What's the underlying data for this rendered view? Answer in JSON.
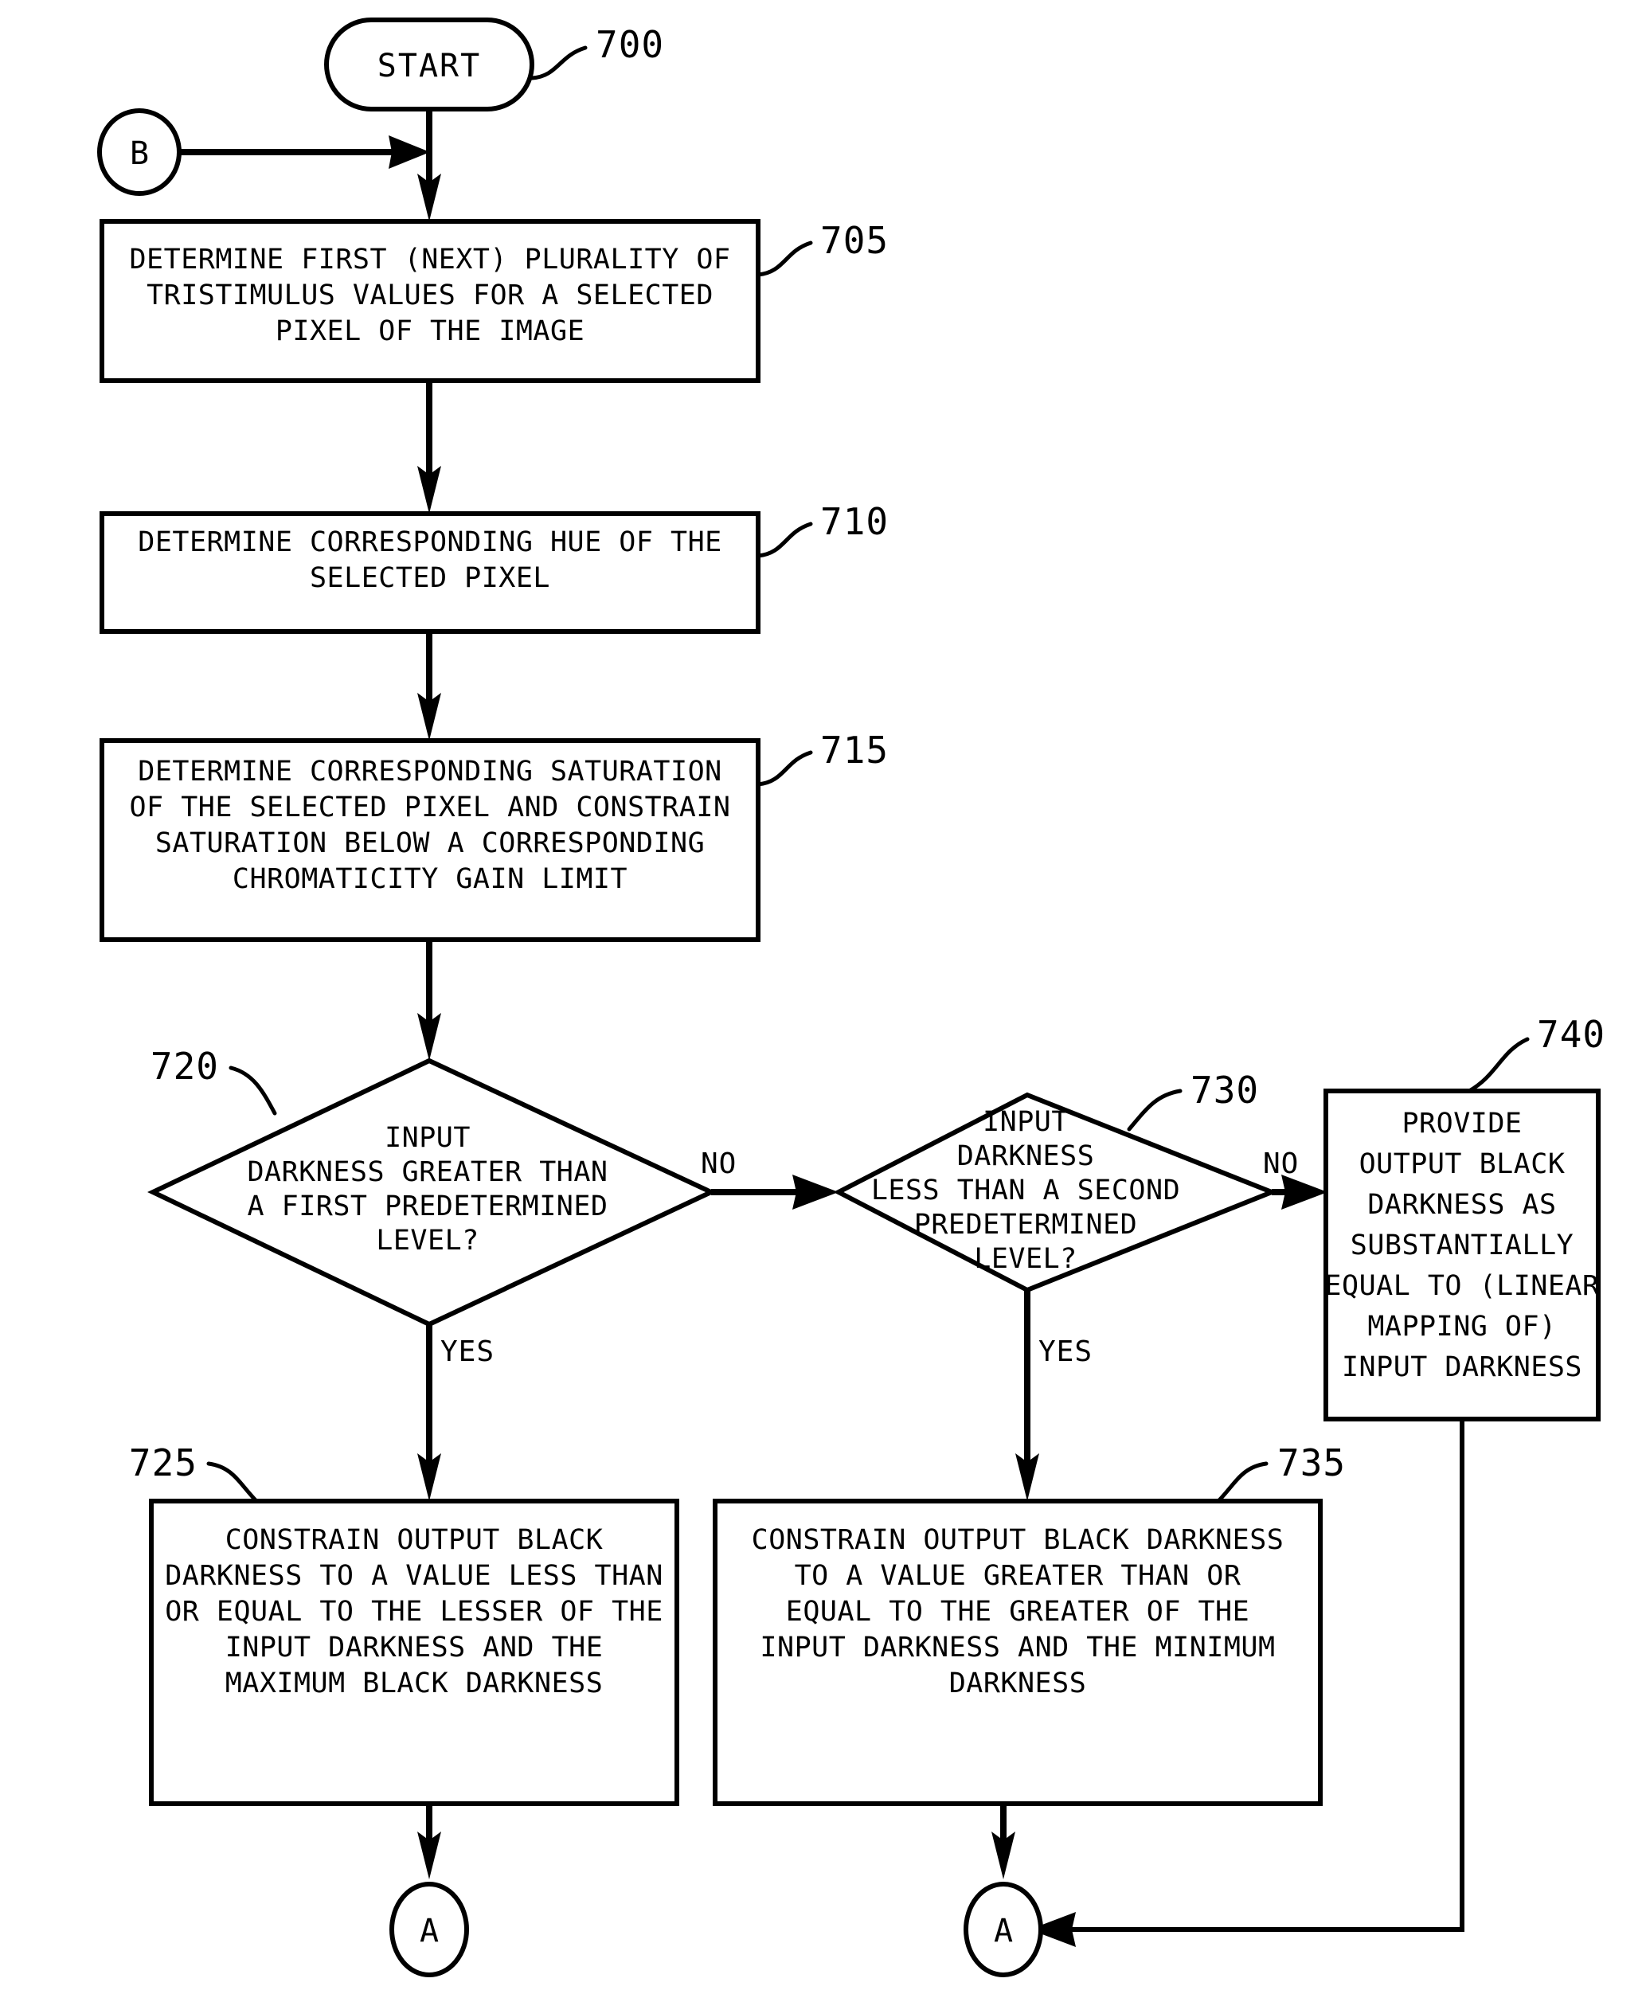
{
  "figure": {
    "type": "patent-flowchart",
    "background_color": "#ffffff",
    "line_color": "#000000"
  },
  "nodes": {
    "start": {
      "label": "START",
      "ref": "700",
      "shape": "rounded-terminator"
    },
    "connector_b": {
      "label": "B",
      "shape": "circle-connector"
    },
    "step_705": {
      "ref": "705",
      "shape": "process",
      "lines": [
        "DETERMINE FIRST (NEXT) PLURALITY OF",
        "TRISTIMULUS VALUES FOR A SELECTED",
        "PIXEL OF THE IMAGE"
      ]
    },
    "step_710": {
      "ref": "710",
      "shape": "process",
      "lines": [
        "DETERMINE CORRESPONDING HUE OF THE",
        "SELECTED PIXEL"
      ]
    },
    "step_715": {
      "ref": "715",
      "shape": "process",
      "lines": [
        "DETERMINE CORRESPONDING SATURATION",
        "OF THE SELECTED PIXEL AND CONSTRAIN",
        "SATURATION BELOW A CORRESPONDING",
        "CHROMATICITY GAIN LIMIT"
      ]
    },
    "decision_720": {
      "ref": "720",
      "shape": "decision",
      "lines": [
        "INPUT",
        "DARKNESS GREATER THAN",
        "A FIRST PREDETERMINED",
        "LEVEL?"
      ],
      "yes_label": "YES",
      "no_label": "NO"
    },
    "decision_730": {
      "ref": "730",
      "shape": "decision",
      "lines": [
        "INPUT",
        "DARKNESS",
        "LESS THAN A SECOND",
        "PREDETERMINED",
        "LEVEL?"
      ],
      "yes_label": "YES",
      "no_label": "NO"
    },
    "step_725": {
      "ref": "725",
      "shape": "process",
      "lines": [
        "CONSTRAIN OUTPUT BLACK",
        "DARKNESS TO A VALUE LESS THAN",
        "OR EQUAL TO THE LESSER OF THE",
        "INPUT DARKNESS AND THE",
        "MAXIMUM BLACK DARKNESS"
      ]
    },
    "step_735": {
      "ref": "735",
      "shape": "process",
      "lines": [
        "CONSTRAIN OUTPUT BLACK DARKNESS",
        "TO A VALUE GREATER THAN OR",
        "EQUAL TO THE GREATER OF THE",
        "INPUT DARKNESS AND THE MINIMUM",
        "DARKNESS"
      ]
    },
    "step_740": {
      "ref": "740",
      "shape": "process",
      "lines": [
        "PROVIDE",
        "OUTPUT BLACK",
        "DARKNESS AS",
        "SUBSTANTIALLY",
        "EQUAL TO (LINEAR",
        "MAPPING OF)",
        "INPUT DARKNESS"
      ]
    },
    "connector_a_left": {
      "label": "A",
      "shape": "circle-connector"
    },
    "connector_a_right": {
      "label": "A",
      "shape": "circle-connector"
    }
  }
}
